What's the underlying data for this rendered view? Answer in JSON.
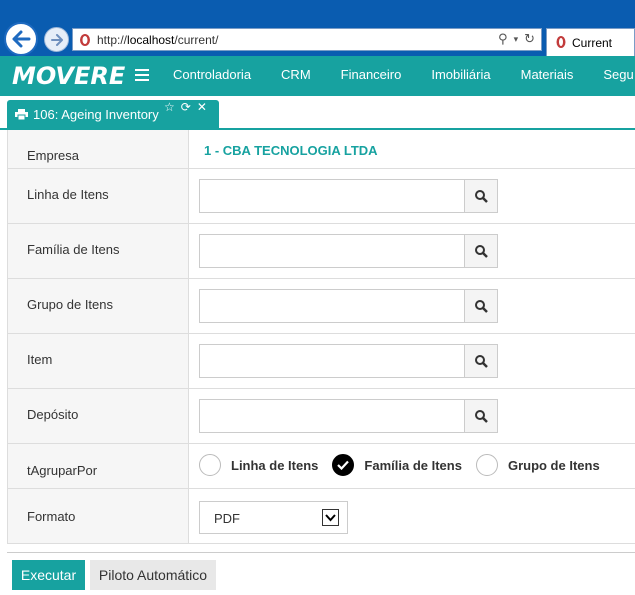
{
  "browser": {
    "url_prefix": "http://",
    "url_host": "localhost",
    "url_path": "/current/",
    "tab_title": "Current"
  },
  "app": {
    "logo": "MOVERE",
    "menu": [
      "Controladoria",
      "CRM",
      "Financeiro",
      "Imobiliária",
      "Materiais",
      "Segu"
    ]
  },
  "panel": {
    "title": "106: Ageing Inventory"
  },
  "form": {
    "empresa_label": "Empresa",
    "empresa_value": "1 - CBA TECNOLOGIA LTDA",
    "lookups": [
      {
        "label": "Linha de Itens",
        "value": ""
      },
      {
        "label": "Família de Itens",
        "value": ""
      },
      {
        "label": "Grupo de Itens",
        "value": ""
      },
      {
        "label": "Item",
        "value": ""
      },
      {
        "label": "Depósito",
        "value": ""
      }
    ],
    "agrupar_label": "tAgruparPor",
    "agrupar_options": [
      "Linha de Itens",
      "Família de Itens",
      "Grupo de Itens"
    ],
    "agrupar_selected": "Família de Itens",
    "formato_label": "Formato",
    "formato_value": "PDF"
  },
  "buttons": {
    "execute": "Executar",
    "auto": "Piloto Automático"
  },
  "colors": {
    "accent": "#17a2a0",
    "browser_chrome": "#0a5cb0"
  }
}
